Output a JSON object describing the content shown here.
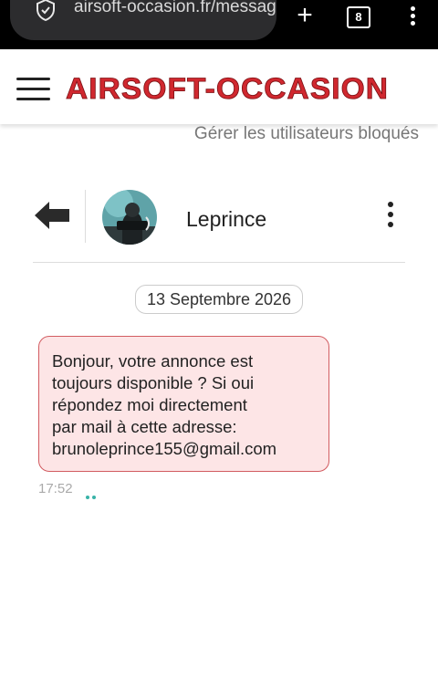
{
  "browser": {
    "url": "airsoft-occasion.fr/messag",
    "tab_count": "8",
    "security_icon": "shield-icon",
    "new_tab_icon": "plus-icon",
    "menu_icon": "vertical-dots-icon"
  },
  "site": {
    "logo_text": "AIRSOFT-OCCASION",
    "menu_icon": "hamburger-menu-icon",
    "brand_color": "#d0282f"
  },
  "page": {
    "manage_blocked_link": "Gérer les utilisateurs bloqués"
  },
  "conversation": {
    "back_icon": "back-arrow-icon",
    "contact_name": "Leprince",
    "more_icon": "vertical-dots-icon",
    "date": "13 Septembre 2026",
    "messages": [
      {
        "lines": [
          "Bonjour, votre annonce est",
          "toujours disponible ? Si oui",
          "répondez moi directement",
          "par mail à cette adresse:",
          "brunoleprince155@gmail.com"
        ],
        "time": "17:52",
        "status_icon": "read-receipt-icon",
        "bubble_bg": "#fde5e6",
        "bubble_border": "#d25c61"
      }
    ]
  }
}
